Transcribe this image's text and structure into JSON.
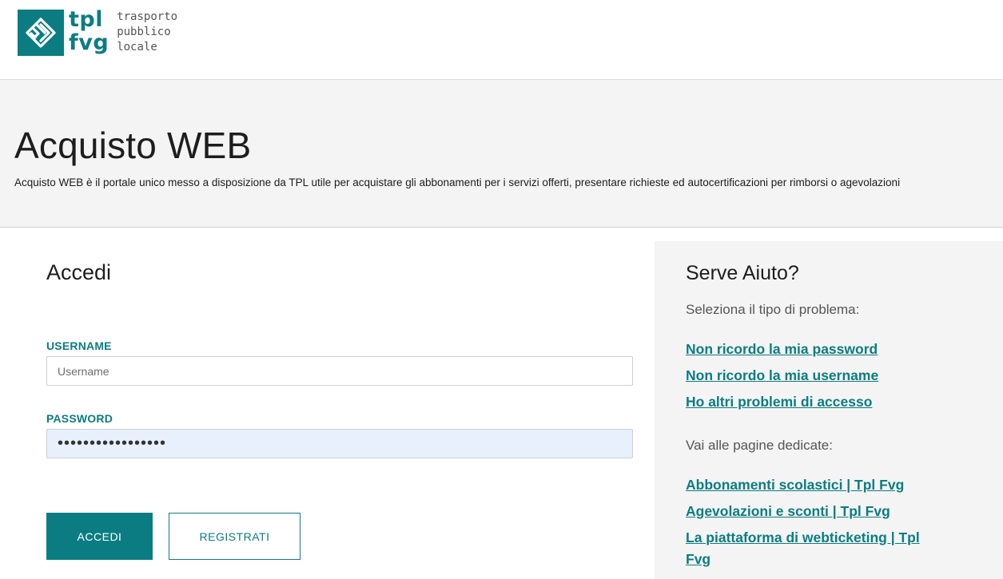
{
  "brand": {
    "logo_icon": "tpl-fvg-logo-icon",
    "name_line1": "tpl",
    "name_line2": "fvg",
    "desc_line1": "trasporto",
    "desc_line2": "pubblico",
    "desc_line3": "locale",
    "color": "#0b7d82"
  },
  "hero": {
    "title": "Acquisto WEB",
    "description": "Acquisto WEB è il portale unico messo a disposizione da TPL utile per acquistare gli abbonamenti per i servizi offerti, presentare richieste ed autocertificazioni per rimborsi o agevolazioni"
  },
  "login": {
    "title": "Accedi",
    "username_label": "USERNAME",
    "username_placeholder": "Username",
    "username_value": "",
    "password_label": "PASSWORD",
    "password_value": "•••••••••••••••••",
    "login_button": "ACCEDI",
    "register_button": "REGISTRATI"
  },
  "help": {
    "title": "Serve Aiuto?",
    "problem_prompt": "Seleziona il tipo di problema:",
    "problem_links": [
      "Non ricordo la mia password",
      "Non ricordo la mia username",
      "Ho altri problemi di accesso"
    ],
    "pages_prompt": "Vai alle pagine dedicate:",
    "page_links": [
      "Abbonamenti scolastici | Tpl Fvg",
      "Agevolazioni e sconti | Tpl Fvg",
      "La piattaforma di webticketing | Tpl Fvg"
    ]
  }
}
